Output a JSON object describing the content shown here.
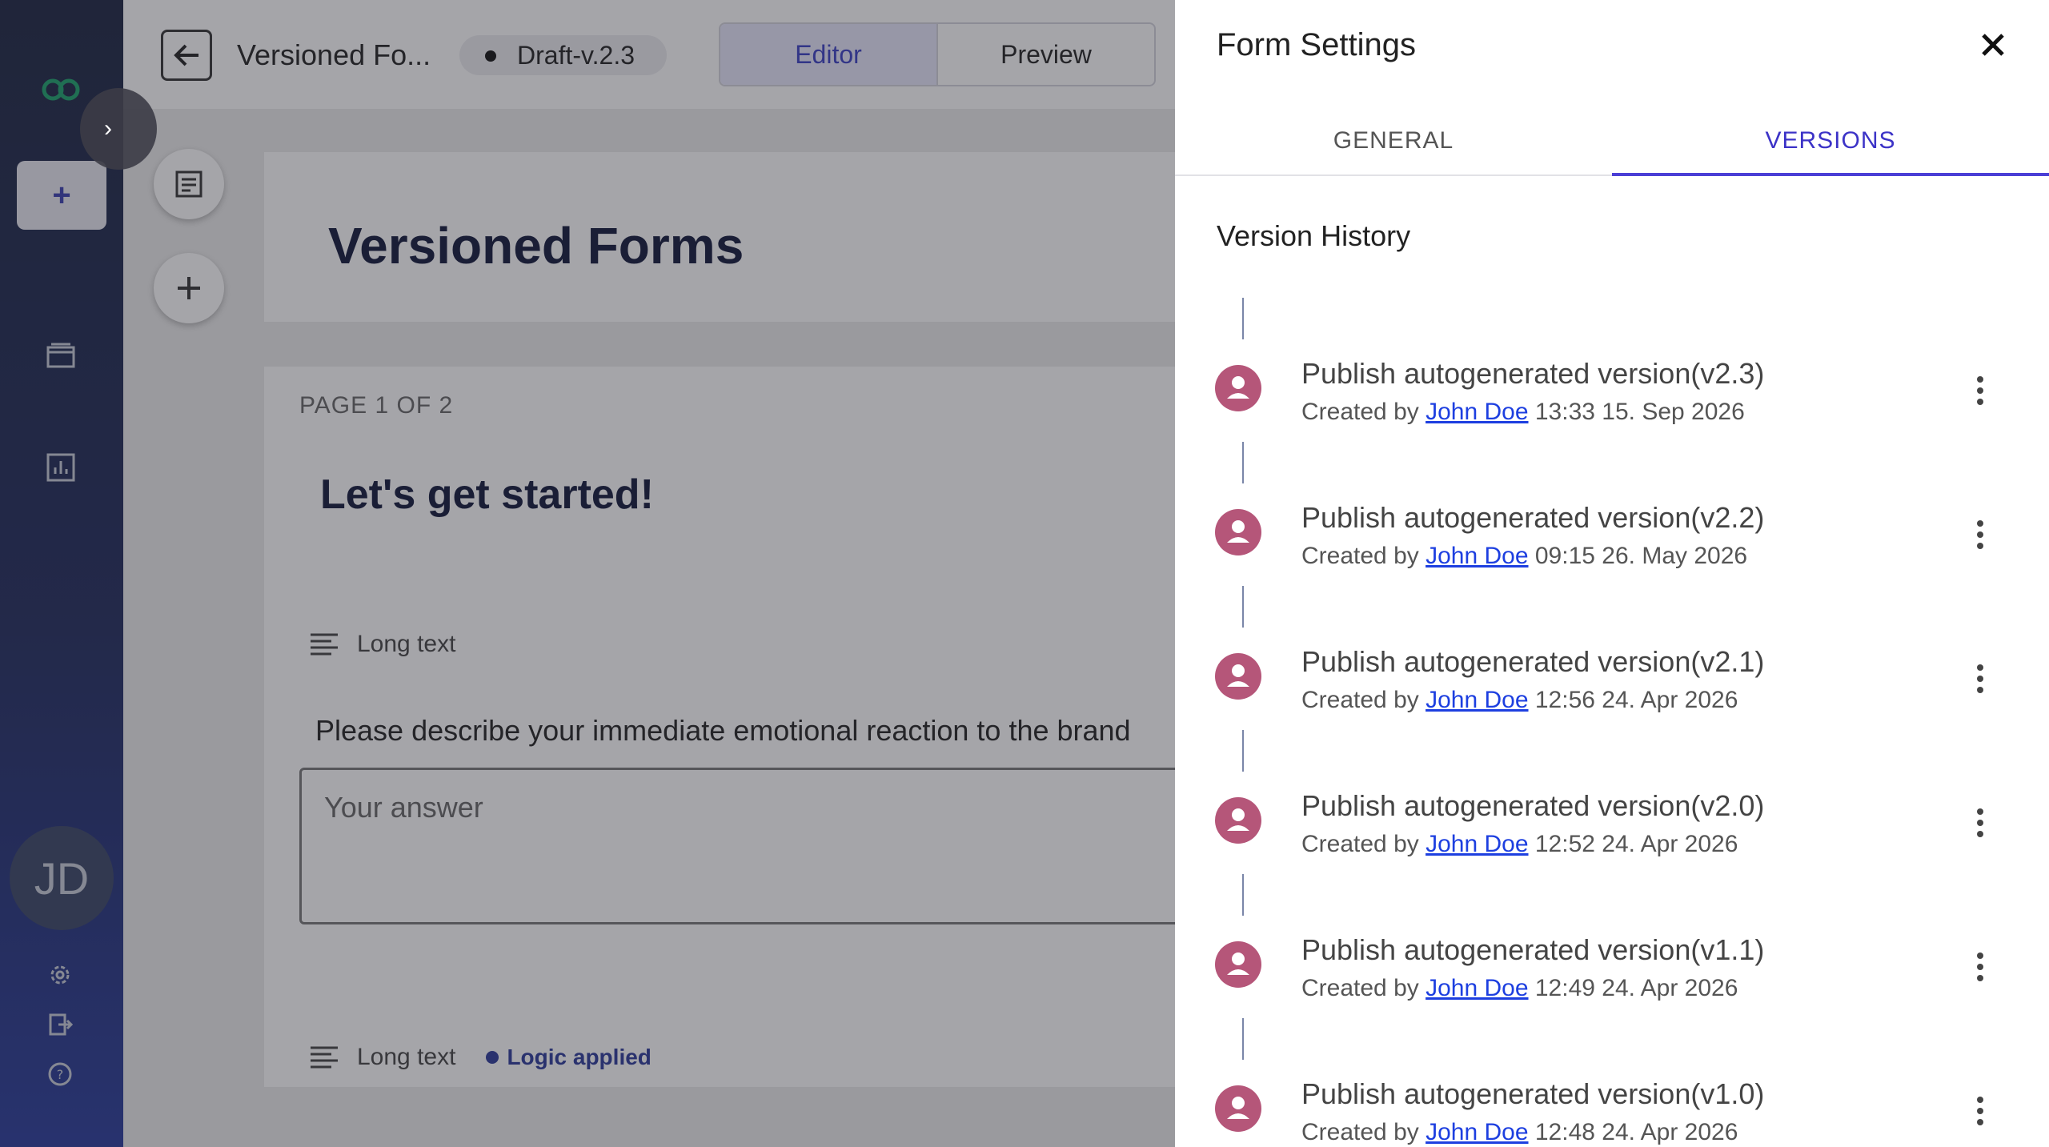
{
  "nav": {
    "user_initials": "JD"
  },
  "header": {
    "form_title": "Versioned Fo...",
    "draft_label": "Draft-v.2.3",
    "tabs": [
      "Editor",
      "Preview"
    ]
  },
  "form": {
    "title": "Versioned Forms",
    "page_indicator": "PAGE 1 OF 2",
    "section_title": "Let's get started!",
    "questions": [
      {
        "type": "Long text",
        "text": "Please describe your immediate emotional reaction to the brand",
        "placeholder": "Your answer"
      },
      {
        "type": "Long text",
        "logic": "Logic applied"
      }
    ]
  },
  "panel": {
    "title": "Form Settings",
    "tabs": [
      "GENERAL",
      "VERSIONS"
    ],
    "active_tab": "VERSIONS",
    "section_title": "Version History",
    "versions": [
      {
        "title": "Publish autogenerated version(v2.3)",
        "created_by": "Created by",
        "author": "John Doe",
        "timestamp": "13:33 15. Sep 2026"
      },
      {
        "title": "Publish autogenerated version(v2.2)",
        "created_by": "Created by",
        "author": "John Doe",
        "timestamp": "09:15 26. May 2026"
      },
      {
        "title": "Publish autogenerated version(v2.1)",
        "created_by": "Created by",
        "author": "John Doe",
        "timestamp": "12:56 24. Apr 2026"
      },
      {
        "title": "Publish autogenerated version(v2.0)",
        "created_by": "Created by",
        "author": "John Doe",
        "timestamp": "12:52 24. Apr 2026"
      },
      {
        "title": "Publish autogenerated version(v1.1)",
        "created_by": "Created by",
        "author": "John Doe",
        "timestamp": "12:49 24. Apr 2026"
      },
      {
        "title": "Publish autogenerated version(v1.0)",
        "created_by": "Created by",
        "author": "John Doe",
        "timestamp": "12:48 24. Apr 2026"
      }
    ]
  },
  "colors": {
    "accent": "#4b3fd6",
    "avatar": "#b55679",
    "link": "#1d3fe0",
    "logo": "#1aa36b"
  }
}
